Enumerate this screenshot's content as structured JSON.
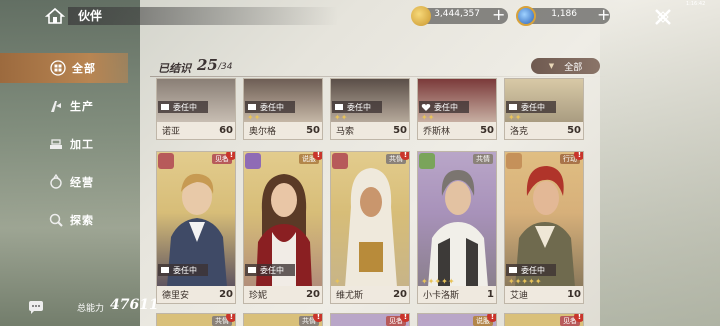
{
  "header": {
    "title": "伙伴",
    "gold": "3,444,357",
    "gems": "1,186",
    "clock": "1:16:42"
  },
  "sidebar": {
    "items": [
      {
        "label": "全部",
        "icon": "grid-icon",
        "active": true
      },
      {
        "label": "生产",
        "icon": "production-icon",
        "active": false
      },
      {
        "label": "加工",
        "icon": "processing-icon",
        "active": false
      },
      {
        "label": "经营",
        "icon": "business-icon",
        "active": false
      },
      {
        "label": "探索",
        "icon": "explore-icon",
        "active": false
      }
    ]
  },
  "footer": {
    "power_label": "总能力",
    "power_value": "47611"
  },
  "main": {
    "known_label": "已结识",
    "known_count": "25",
    "known_total": "/34",
    "filter_label": "全部"
  },
  "status_text": "委任中",
  "cards_top": [
    {
      "name": "诺亚",
      "level": "60",
      "task": true,
      "stars": ""
    },
    {
      "name": "奥尔格",
      "level": "50",
      "task": true,
      "stars": "✦✦"
    },
    {
      "name": "马索",
      "level": "50",
      "task": true,
      "stars": "✦✦"
    },
    {
      "name": "乔斯林",
      "level": "50",
      "task": true,
      "stars": "✦✦"
    },
    {
      "name": "洛克",
      "level": "50",
      "task": true,
      "stars": "✦✦"
    }
  ],
  "cards_mid": [
    {
      "name": "德里安",
      "level": "20",
      "task": true,
      "stars": "",
      "tag": "见者",
      "tag_color": "#b75a5a",
      "bg": "#d9c07a"
    },
    {
      "name": "珍妮",
      "level": "20",
      "task": true,
      "stars": "",
      "tag": "说服",
      "tag_color": "#8f6bb5",
      "bg": "#d9c07a"
    },
    {
      "name": "维尤斯",
      "level": "20",
      "task": false,
      "stars": "✦",
      "tag": "共情",
      "tag_color": "#8f6bb5",
      "bg": "#d9c07a"
    },
    {
      "name": "小卡洛斯",
      "level": "1",
      "task": false,
      "stars": "✦✦✦✦✦",
      "tag": "共情",
      "tag_color": "#8f6bb5",
      "bg": "#b9a6c8"
    },
    {
      "name": "艾迪",
      "level": "10",
      "task": true,
      "stars": "✦✦✦✦✦",
      "tag": "行动",
      "tag_color": "#c5915a",
      "bg": "#d9b273"
    }
  ],
  "cards_bot_tags": [
    "共情",
    "共情",
    "见者",
    "说服",
    "见者"
  ],
  "colors": {
    "sidebar_active": "#b88552",
    "alert": "#c9352b",
    "star": "#e8c35a"
  }
}
